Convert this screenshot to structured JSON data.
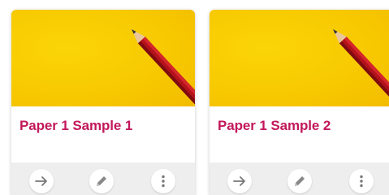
{
  "cards": [
    {
      "title": "Paper 1 Sample 1",
      "thumbnail": "yellow-background-with-red-pencil",
      "actions": [
        "arrow-right-icon",
        "pencil-icon",
        "more-vertical-icon"
      ]
    },
    {
      "title": "Paper 1 Sample 2",
      "thumbnail": "yellow-background-with-red-pencil",
      "actions": [
        "arrow-right-icon",
        "pencil-icon",
        "more-vertical-icon"
      ]
    }
  ],
  "colors": {
    "title": "#c2185b",
    "thumbnail_bg": "#f7c800",
    "pencil": "#b3121a",
    "action_bar": "#eeeeee",
    "icon": "#777777"
  }
}
